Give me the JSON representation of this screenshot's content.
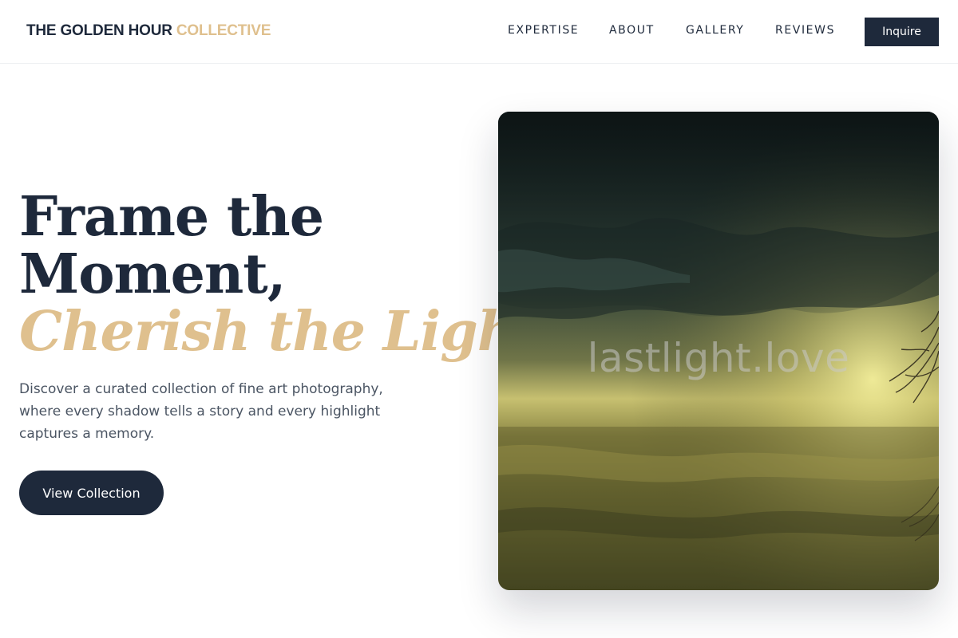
{
  "brand": {
    "name": "THE GOLDEN HOUR",
    "accent": "COLLECTIVE"
  },
  "nav": {
    "items": [
      {
        "label": "EXPERTISE"
      },
      {
        "label": "ABOUT"
      },
      {
        "label": "GALLERY"
      },
      {
        "label": "REVIEWS"
      }
    ],
    "cta_label": "Inquire"
  },
  "hero": {
    "headline_line1": "Frame the",
    "headline_line2": "Moment,",
    "headline_accent": "Cherish the Light.",
    "description": "Discover a curated collection of fine art photography, where every shadow tells a story and every highlight captures a memory.",
    "button_label": "View Collection",
    "image_watermark": "lastlight.love"
  },
  "colors": {
    "primary": "#1e293b",
    "accent": "#dfc08e",
    "body_text": "#4b5563",
    "background": "#ffffff"
  }
}
